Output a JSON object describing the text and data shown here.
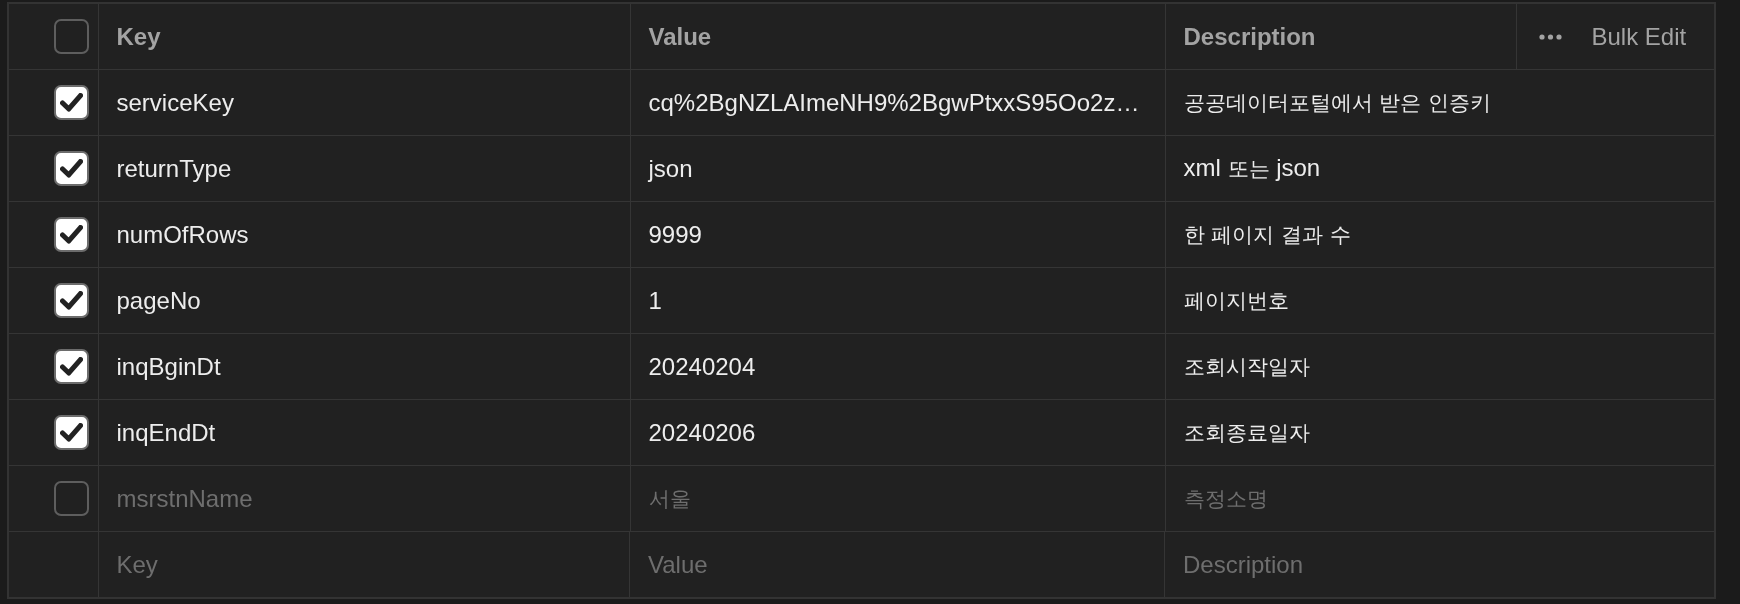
{
  "params_table": {
    "header": {
      "select_all": {
        "checked": false
      },
      "columns": [
        {
          "label": "Key"
        },
        {
          "label": "Value"
        },
        {
          "label": "Description"
        }
      ],
      "bulk_edit": "Bulk Edit"
    },
    "rows": [
      {
        "checked": true,
        "key": "serviceKey",
        "value": "cq%2BgNZLAImeNH9%2BgwPtxxS95Oo2z…",
        "description": "공공데이터포털에서 받은 인증키"
      },
      {
        "checked": true,
        "key": "returnType",
        "value": "json",
        "description": "xml 또는 json"
      },
      {
        "checked": true,
        "key": "numOfRows",
        "value": "9999",
        "description": "한 페이지 결과 수"
      },
      {
        "checked": true,
        "key": "pageNo",
        "value": "1",
        "description": "페이지번호"
      },
      {
        "checked": true,
        "key": "inqBginDt",
        "value": "20240204",
        "description": "조회시작일자"
      },
      {
        "checked": true,
        "key": "inqEndDt",
        "value": "20240206",
        "description": "조회종료일자"
      },
      {
        "checked": false,
        "key": "msrstnName",
        "value": "서울",
        "description": "측정소명"
      }
    ],
    "new_row": {
      "key": {
        "placeholder": "Key"
      },
      "value": {
        "placeholder": "Value"
      },
      "description": {
        "placeholder": "Description"
      }
    }
  }
}
